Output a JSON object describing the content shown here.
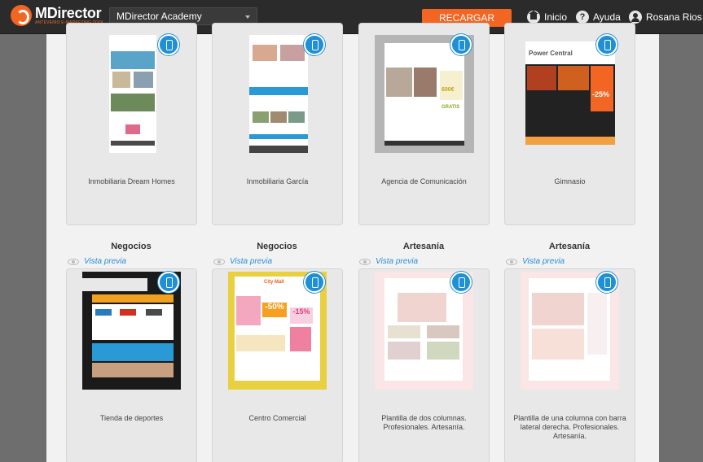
{
  "header": {
    "logo_name": "MDirector",
    "logo_tagline": "ANTEVENIO E-MARKETING TOOL",
    "account": "MDirector Academy",
    "recharge_label": "RECARGAR SALDO",
    "nav": [
      {
        "label": "Inicio",
        "icon": "home-icon"
      },
      {
        "label": "Ayuda",
        "icon": "help-icon"
      },
      {
        "label": "Rosana Rios",
        "icon": "user-icon"
      }
    ]
  },
  "preview_label": "Vista previa",
  "templates_row1": [
    {
      "name": "Inmobiliaria Dream Homes"
    },
    {
      "name": "Inmobiliaria García"
    },
    {
      "name": "Agencia de Comunicación"
    },
    {
      "name": "Gimnasio"
    }
  ],
  "templates_row2": [
    {
      "category": "Negocios",
      "name": "Tienda de deportes"
    },
    {
      "category": "Negocios",
      "name": "Centro Comercial"
    },
    {
      "category": "Artesanía",
      "name": "Plantilla de dos columnas. Profesionales. Artesanía."
    },
    {
      "category": "Artesanía",
      "name": "Plantilla de una columna con barra lateral derecha. Profesionales. Artesanía."
    }
  ],
  "thumb_text": {
    "gym_brand": "Power Central",
    "gym_discount": "-25%",
    "agency_price": "600€",
    "agency_free": "GRATIS",
    "mall_brand": "City Mall",
    "mall_discount1": "-50%",
    "mall_discount2": "-15%"
  }
}
